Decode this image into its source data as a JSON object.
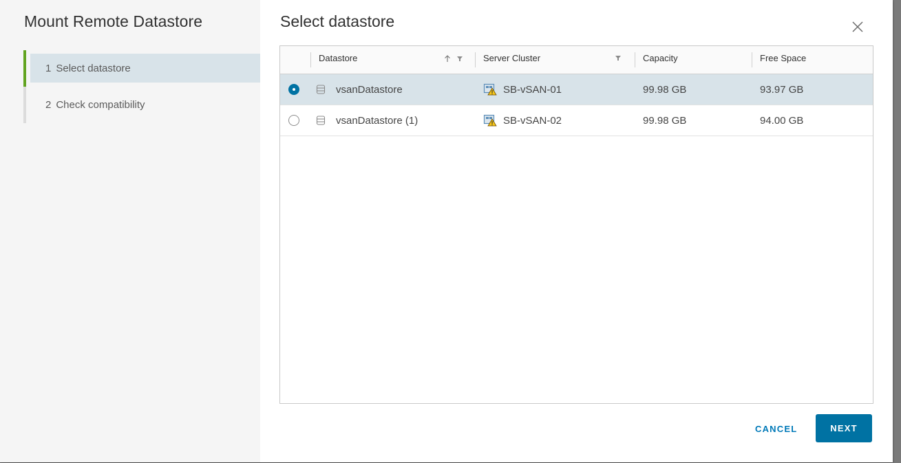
{
  "wizard": {
    "title": "Mount Remote Datastore",
    "steps": [
      {
        "num": "1",
        "label": "Select datastore"
      },
      {
        "num": "2",
        "label": "Check compatibility"
      }
    ]
  },
  "main": {
    "title": "Select datastore",
    "close_icon": "close-icon"
  },
  "grid": {
    "columns": {
      "datastore": "Datastore",
      "server_cluster": "Server Cluster",
      "capacity": "Capacity",
      "free_space": "Free Space"
    },
    "sort": {
      "column": "Datastore",
      "direction": "ascending"
    },
    "rows": [
      {
        "selected": true,
        "datastore": "vsanDatastore",
        "server_cluster": "SB-vSAN-01",
        "capacity": "99.98 GB",
        "free_space": "93.97 GB"
      },
      {
        "selected": false,
        "datastore": "vsanDatastore (1)",
        "server_cluster": "SB-vSAN-02",
        "capacity": "99.98 GB",
        "free_space": "94.00 GB"
      }
    ]
  },
  "footer": {
    "cancel_label": "CANCEL",
    "next_label": "NEXT"
  },
  "colors": {
    "accent": "#0072a3",
    "active_step_bar": "#62a420",
    "selected_row": "#d8e3e9",
    "warning": "#f5c518"
  }
}
